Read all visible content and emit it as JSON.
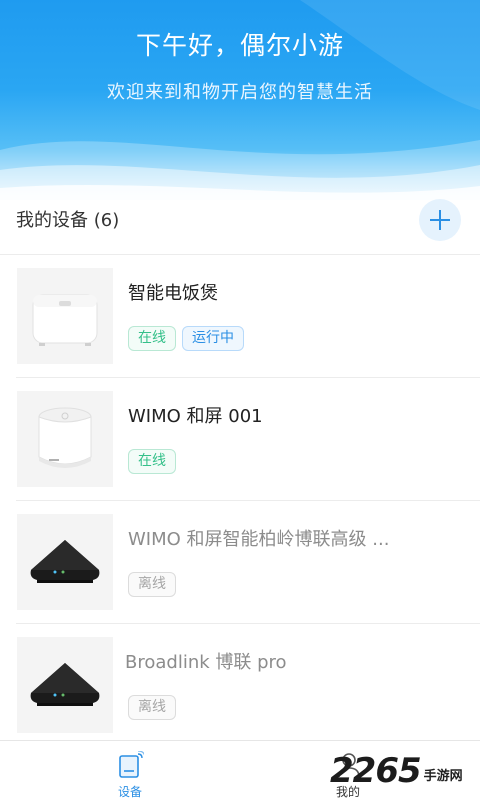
{
  "header": {
    "greeting": "下午好，偶尔小游",
    "welcome": "欢迎来到和物开启您的智慧生活"
  },
  "devices_section": {
    "title": "我的设备 (6)",
    "add_icon": "plus-icon"
  },
  "devices": [
    {
      "name": "智能电饭煲",
      "status": "在线",
      "extra": "运行中",
      "image": "rice-cooker-image",
      "online": true
    },
    {
      "name": "WIMO 和屏 001",
      "status": "在线",
      "image": "wimo-speaker-image",
      "online": true
    },
    {
      "name": "WIMO 和屏智能柏岭博联高级 ...",
      "status": "离线",
      "image": "broadlink-hub-image",
      "online": false
    },
    {
      "name": "Broadlink 博联 pro",
      "status": "离线",
      "image": "broadlink-hub-image",
      "online": false
    }
  ],
  "bottom_nav": {
    "devices_label": "设备",
    "mine_label": "我的",
    "active_color": "#2b8fe4"
  },
  "watermark": {
    "number": "2265",
    "text": "手游网"
  },
  "colors": {
    "header_top": "#1f9bf0",
    "online": "#35c08a",
    "running": "#2b8fe4",
    "offline": "#a6a6a6"
  }
}
